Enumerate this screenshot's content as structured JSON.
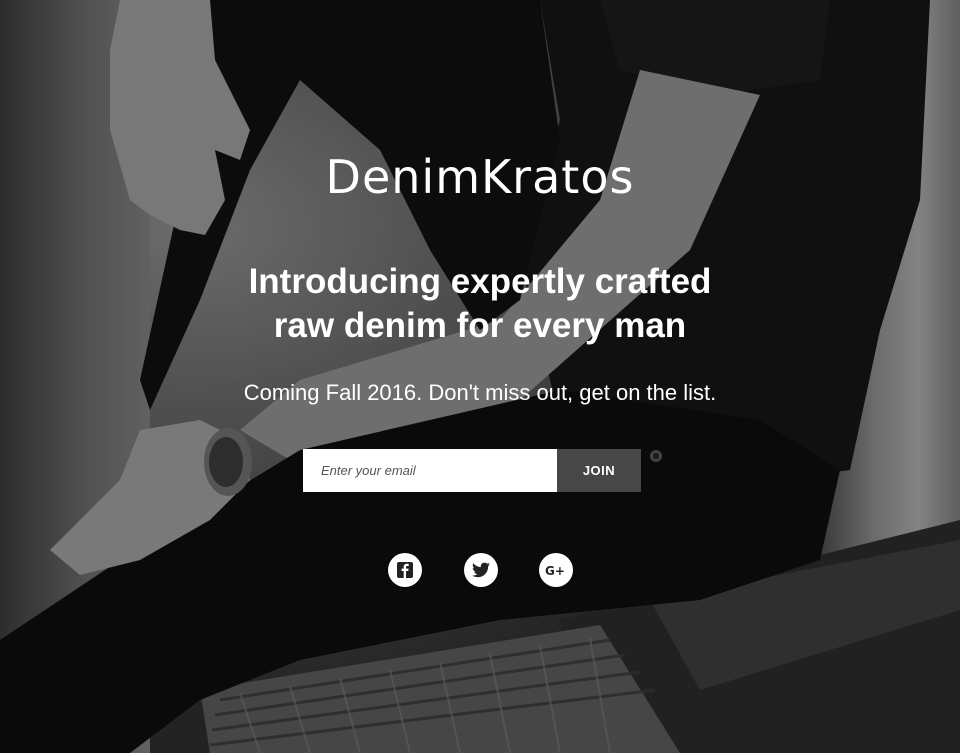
{
  "brand": {
    "logo_text": "DenimKratos"
  },
  "hero": {
    "headline_line1": "Introducing expertly crafted",
    "headline_line2": "raw denim for every man",
    "subline": "Coming Fall 2016. Don't miss out, get on the list."
  },
  "signup": {
    "email_placeholder": "Enter your email",
    "email_value": "",
    "join_label": "JOIN"
  },
  "social": [
    {
      "icon": "facebook-icon"
    },
    {
      "icon": "twitter-icon"
    },
    {
      "icon": "google-plus-icon",
      "label": "G+"
    }
  ],
  "colors": {
    "text": "#ffffff",
    "join_button_bg": "#474747",
    "input_bg": "#ffffff",
    "social_icon_bg": "#ffffff",
    "social_icon_fg": "#222222"
  }
}
